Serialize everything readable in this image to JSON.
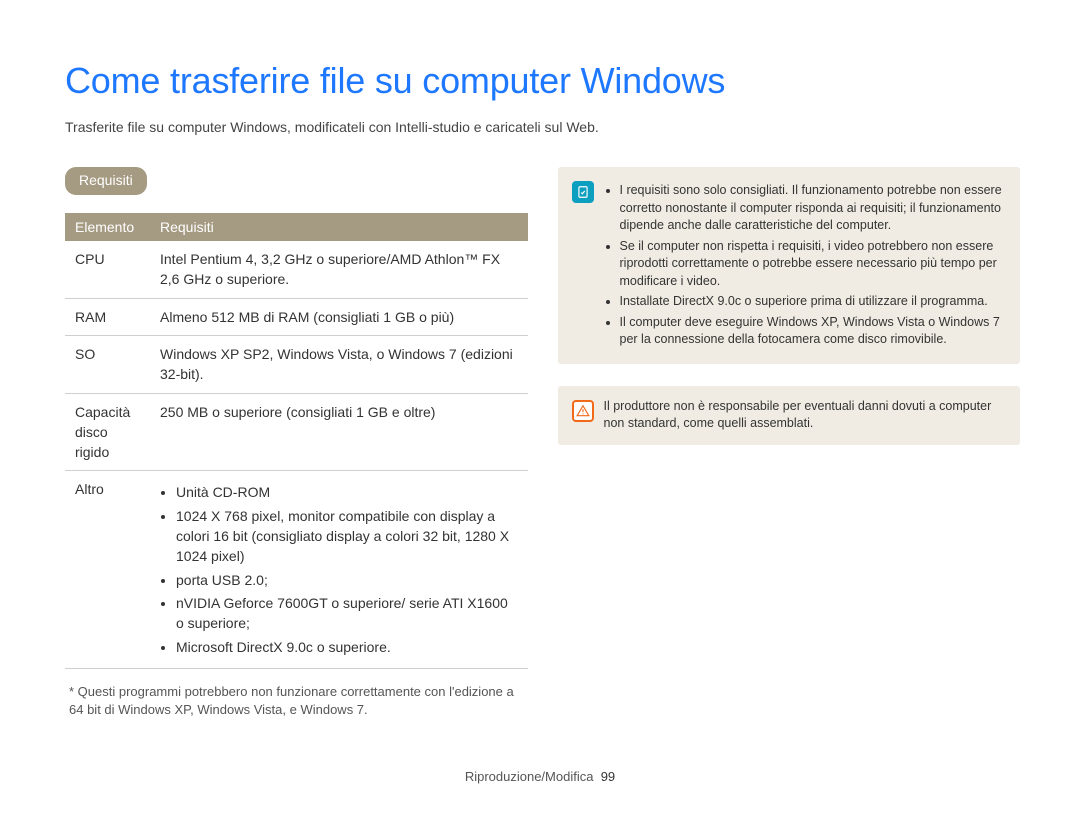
{
  "title": "Come trasferire file su computer Windows",
  "subtitle": "Trasferite file su computer Windows, modificateli con Intelli-studio e caricateli sul Web.",
  "pill_requisiti": "Requisiti",
  "table": {
    "head_elemento": "Elemento",
    "head_requisiti": "Requisiti",
    "rows": {
      "cpu_label": "CPU",
      "cpu_val": "Intel Pentium 4, 3,2 GHz o superiore/AMD Athlon™ FX 2,6 GHz o superiore.",
      "ram_label": "RAM",
      "ram_val": "Almeno 512 MB di RAM (consigliati 1 GB o più)",
      "so_label": "SO",
      "so_val": "Windows XP SP2, Windows Vista, o Windows 7 (edizioni 32-bit).",
      "hdd_label": "Capacità disco rigido",
      "hdd_val": "250 MB o superiore (consigliati 1 GB e oltre)",
      "altro_label": "Altro",
      "altro_items": {
        "i0": "Unità CD-ROM",
        "i1": "1024 X 768 pixel, monitor compatibile con display a colori 16 bit (consigliato display a colori 32 bit, 1280 X 1024 pixel)",
        "i2": "porta USB 2.0;",
        "i3": "nVIDIA Geforce 7600GT o superiore/ serie ATI X1600 o superiore;",
        "i4": "Microsoft DirectX 9.0c o superiore."
      }
    }
  },
  "footnote": "* Questi programmi potrebbero non funzionare correttamente con l'edizione a 64 bit di Windows XP, Windows Vista, e Windows 7.",
  "info_items": {
    "n0": "I requisiti sono solo consigliati. Il funzionamento potrebbe non essere corretto nonostante il computer risponda ai requisiti; il funzionamento dipende anche dalle caratteristiche del computer.",
    "n1": "Se il computer non rispetta i requisiti, i video potrebbero non essere riprodotti correttamente o potrebbe essere necessario più tempo per modificare i video.",
    "n2": "Installate DirectX 9.0c o superiore prima di utilizzare il programma.",
    "n3": "Il computer deve eseguire Windows XP, Windows Vista o Windows 7 per la connessione della fotocamera come disco rimovibile."
  },
  "warn_text": "Il produttore non è responsabile per eventuali danni dovuti a computer non standard, come quelli assemblati.",
  "footer_section": "Riproduzione/Modifica",
  "footer_page": "99"
}
